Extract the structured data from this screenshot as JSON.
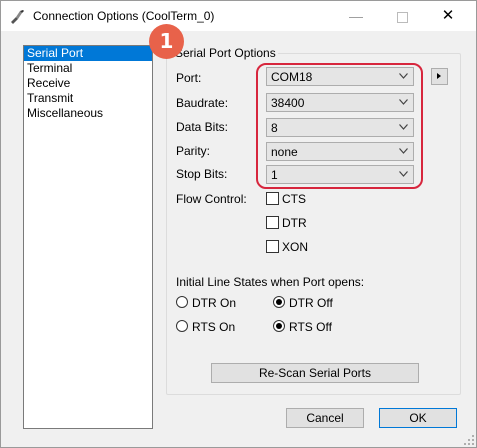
{
  "window": {
    "title": "Connection Options (CoolTerm_0)"
  },
  "titlebar_buttons": {
    "minimize": "—",
    "close": "✕"
  },
  "sidebar": {
    "items": [
      {
        "label": "Serial Port",
        "selected": true
      },
      {
        "label": "Terminal"
      },
      {
        "label": "Receive"
      },
      {
        "label": "Transmit"
      },
      {
        "label": "Miscellaneous"
      }
    ]
  },
  "serial_options": {
    "title": "Serial Port Options",
    "port": {
      "label": "Port:",
      "value": "COM18"
    },
    "baudrate": {
      "label": "Baudrate:",
      "value": "38400"
    },
    "data_bits": {
      "label": "Data Bits:",
      "value": "8"
    },
    "parity": {
      "label": "Parity:",
      "value": "none"
    },
    "stop_bits": {
      "label": "Stop Bits:",
      "value": "1"
    },
    "flow_control": {
      "label": "Flow Control:",
      "options": [
        {
          "label": "CTS",
          "checked": false
        },
        {
          "label": "DTR",
          "checked": false
        },
        {
          "label": "XON",
          "checked": false
        }
      ]
    },
    "line_states": {
      "label": "Initial Line States when Port opens:",
      "dtr_on": "DTR On",
      "dtr_off": "DTR Off",
      "rts_on": "RTS On",
      "rts_off": "RTS Off",
      "dtr_selected": "DTR Off",
      "rts_selected": "RTS Off"
    },
    "rescan_button": "Re-Scan Serial Ports"
  },
  "footer": {
    "cancel": "Cancel",
    "ok": "OK"
  },
  "annotation": {
    "badge": "1",
    "color": "#d7263d"
  },
  "colors": {
    "selection": "#0078d7",
    "badge_fill": "#e8624a"
  }
}
